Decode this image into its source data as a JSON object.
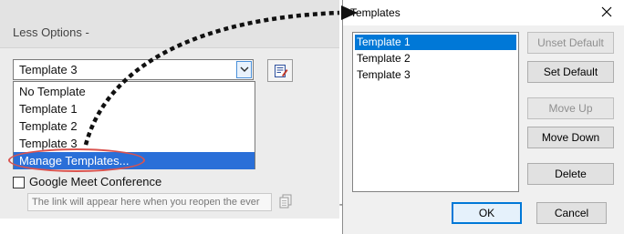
{
  "panel": {
    "less_options_label": "Less Options -",
    "template_select_value": "Template 3",
    "dropdown_options": [
      "No Template",
      "Template 1",
      "Template 2",
      "Template 3",
      "Manage Templates..."
    ],
    "selected_option": "Manage Templates...",
    "google_meet_label": "Google Meet Conference",
    "google_meet_checked": false,
    "link_placeholder": "The link will appear here when you reopen the ever",
    "background_fragment": "T"
  },
  "dialog": {
    "title": "Templates",
    "templates": [
      "Template 1",
      "Template 2",
      "Template 3"
    ],
    "selected_template": "Template 1",
    "buttons": {
      "unset_default": "Unset Default",
      "set_default": "Set Default",
      "move_up": "Move Up",
      "move_down": "Move Down",
      "delete": "Delete",
      "ok": "OK",
      "cancel": "Cancel"
    },
    "disabled_buttons": [
      "unset_default",
      "move_up"
    ]
  },
  "icons": {
    "dropdown_arrow": "chevron-down-icon",
    "edit_template": "edit-template-icon",
    "copy": "copy-icon",
    "close": "close-icon",
    "annotation_arrow": "dotted-arrow-icon"
  },
  "colors": {
    "selection_blue": "#2a6fd8",
    "dialog_selection": "#0078d7",
    "annotation_red": "#d9534f",
    "arrow_black": "#111111"
  }
}
